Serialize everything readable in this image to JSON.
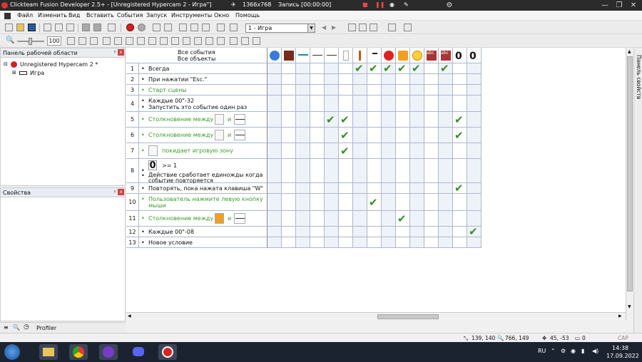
{
  "window": {
    "title": "Clickteam Fusion Developer 2.5+ - [Unregistered Hypercam 2 - Игра\"]",
    "minimize": "—",
    "maximize": "❐",
    "close": "✕"
  },
  "recorder": {
    "resolution": "1366x768",
    "status": "Запись [00:00:00]"
  },
  "menu": [
    "Файл",
    "Изменить",
    "Вид",
    "Вставить",
    "События",
    "Запуск",
    "Инструменты",
    "Окно",
    "Помощь"
  ],
  "toolbar": {
    "frame_select": "1 - Игра",
    "zoom": "100"
  },
  "workspace_panel": {
    "title": "Панель рабочей области",
    "pin": "ᵖ",
    "close": "x",
    "tree": {
      "root": "Unregistered Hypercam 2 *",
      "child": "Игра"
    }
  },
  "properties_panel": {
    "title": "Свойства",
    "pin": "ᵖ",
    "close": "x"
  },
  "left_bottom_tabs": {
    "profiler": "Profiler"
  },
  "event_editor": {
    "header": {
      "line1": "Все события",
      "line2": "Все объекты"
    },
    "rows": [
      {
        "num": "1",
        "text": "Всегда",
        "green": false
      },
      {
        "num": "2",
        "text": "При нажатии \"Esc.\"",
        "green": false
      },
      {
        "num": "3",
        "text": "Старт сцены",
        "green": true
      },
      {
        "num": "4",
        "text": "Каждые 00\"-32",
        "text2": "Запустить это событие один раз",
        "green": false
      },
      {
        "num": "5",
        "text": "Столкновение между",
        "and": "и",
        "green": true
      },
      {
        "num": "6",
        "text": "Столкновение между",
        "and": "и",
        "green": true
      },
      {
        "num": "7",
        "text": "покидает игровую зону",
        "green": true
      },
      {
        "num": "8",
        "text": ">= 1",
        "text2": "Действие сработает единожды когда",
        "text3": "событие повторяется",
        "green": false
      },
      {
        "num": "9",
        "text": "Повторять, пока нажата клавиша \"W\"",
        "green": false
      },
      {
        "num": "10",
        "text": "Пользователь нажмите левую кнопку",
        "text2": "мыши",
        "green": true
      },
      {
        "num": "11",
        "text": "Столкновение между",
        "and": "и",
        "green": true
      },
      {
        "num": "12",
        "text": "Каждые 00\"-08",
        "green": false
      },
      {
        "num": "13",
        "text": "Новое условие",
        "green": false
      }
    ],
    "object_labels": {
      "counter": "0",
      "abc": "abc"
    }
  },
  "right_tab": "Панель свойств",
  "status": {
    "coords1": "139, 140",
    "coords2": "766, 149",
    "coords3": "45, -53",
    "count": "0",
    "caps": "CAP NUM"
  },
  "taskbar": {
    "lang": "RU",
    "time": "14:38",
    "date": "17.09.2022"
  },
  "colors": {
    "green_text": "#3a9a2a",
    "check": "#3a8a22",
    "grid_line": "#aeb8c8",
    "taskbar": "#1c2330"
  }
}
